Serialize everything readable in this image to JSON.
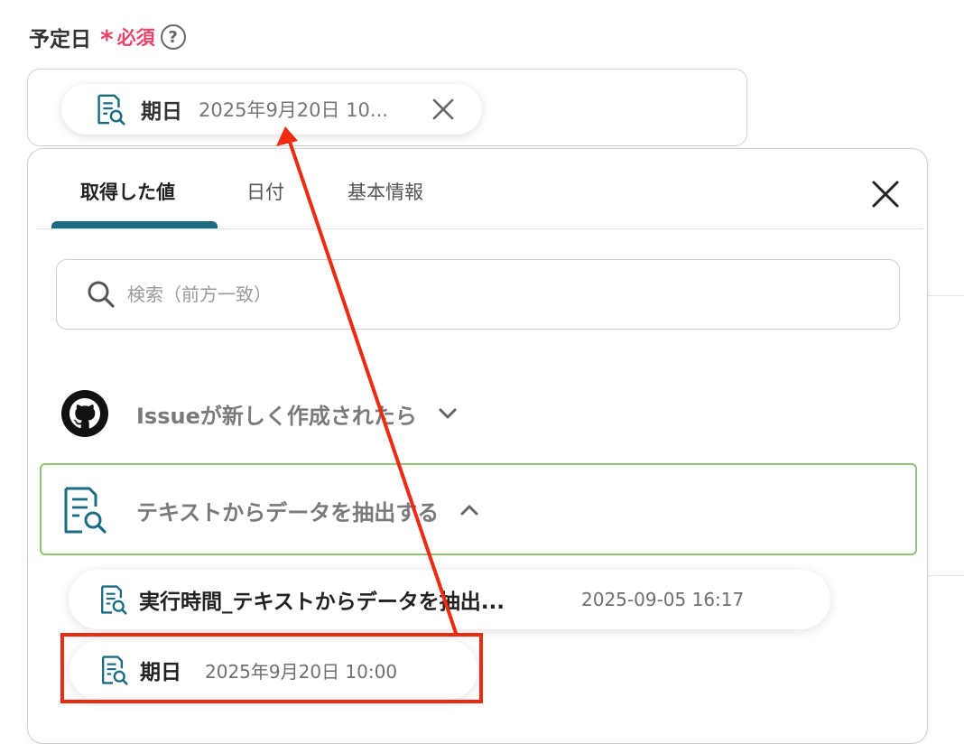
{
  "field": {
    "label": "予定日",
    "required_mark": "*",
    "required_text": "必須",
    "help_icon_text": "?",
    "chip": {
      "name": "期日",
      "value": "2025年9月20日 10...",
      "icon": "document-search-icon"
    }
  },
  "panel": {
    "tabs": [
      "取得した値",
      "日付",
      "基本情報"
    ],
    "active_tab": "取得した値",
    "search_placeholder": "検索（前方一致）",
    "groups": [
      {
        "label": "Issueが新しく作成されたら",
        "icon": "github-icon",
        "expanded": false
      },
      {
        "label": "テキストからデータを抽出する",
        "icon": "document-search-icon",
        "expanded": true
      }
    ],
    "items": [
      {
        "name": "実行時間_テキストからデータを抽出...",
        "value": "2025-09-05 16:17"
      },
      {
        "name": "期日",
        "value": "2025年9月20日 10:00"
      }
    ]
  },
  "colors": {
    "accent": "#1b6c80",
    "required": "#e9456b",
    "selected_border": "#8ec47a",
    "annotation_red": "#ee2a12"
  }
}
